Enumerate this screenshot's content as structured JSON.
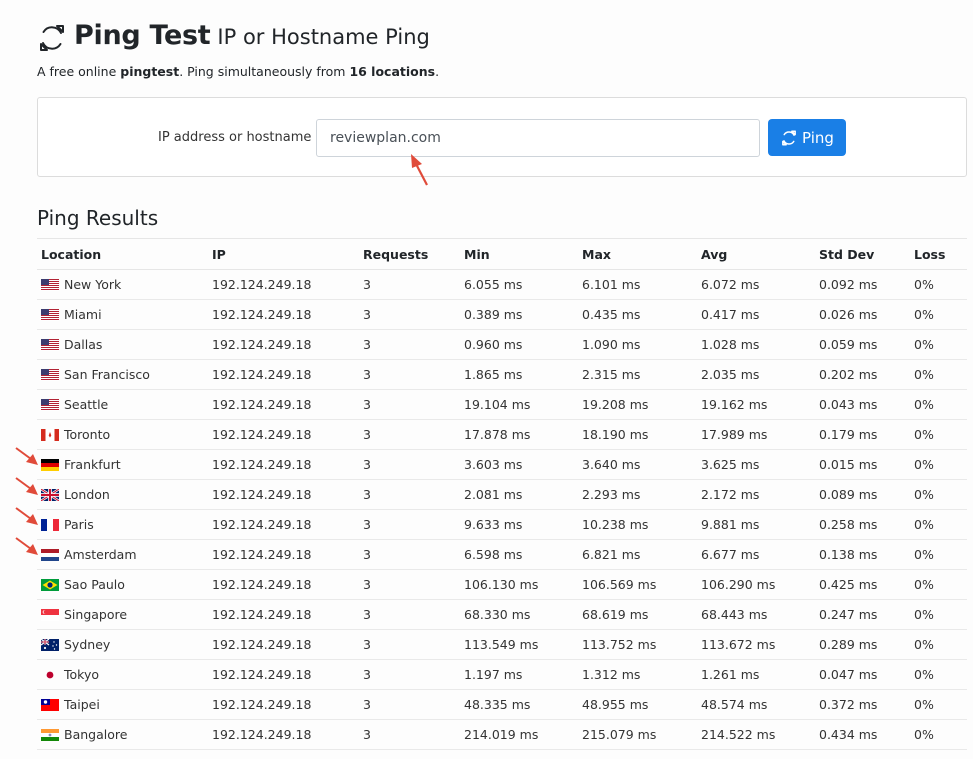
{
  "header": {
    "title": "Ping Test",
    "subtitle": "IP or Hostname Ping",
    "tagline_prefix": "A free online ",
    "tagline_bold1": "pingtest",
    "tagline_middle": ". Ping simultaneously from ",
    "tagline_bold2": "16 locations",
    "tagline_suffix": ".",
    "icon": "refresh-icon"
  },
  "form": {
    "label": "IP address or hostname",
    "input_value": "reviewplan.com",
    "button_label": "Ping",
    "button_icon": "refresh-icon",
    "button_color": "#1a7fe6"
  },
  "results": {
    "title": "Ping Results",
    "columns": [
      "Location",
      "IP",
      "Requests",
      "Min",
      "Max",
      "Avg",
      "Std Dev",
      "Loss"
    ],
    "rows": [
      {
        "flag": "us",
        "location": "New York",
        "ip": "192.124.249.18",
        "requests": "3",
        "min": "6.055 ms",
        "max": "6.101 ms",
        "avg": "6.072 ms",
        "std": "0.092 ms",
        "loss": "0%"
      },
      {
        "flag": "us",
        "location": "Miami",
        "ip": "192.124.249.18",
        "requests": "3",
        "min": "0.389 ms",
        "max": "0.435 ms",
        "avg": "0.417 ms",
        "std": "0.026 ms",
        "loss": "0%"
      },
      {
        "flag": "us",
        "location": "Dallas",
        "ip": "192.124.249.18",
        "requests": "3",
        "min": "0.960 ms",
        "max": "1.090 ms",
        "avg": "1.028 ms",
        "std": "0.059 ms",
        "loss": "0%"
      },
      {
        "flag": "us",
        "location": "San Francisco",
        "ip": "192.124.249.18",
        "requests": "3",
        "min": "1.865 ms",
        "max": "2.315 ms",
        "avg": "2.035 ms",
        "std": "0.202 ms",
        "loss": "0%"
      },
      {
        "flag": "us",
        "location": "Seattle",
        "ip": "192.124.249.18",
        "requests": "3",
        "min": "19.104 ms",
        "max": "19.208 ms",
        "avg": "19.162 ms",
        "std": "0.043 ms",
        "loss": "0%"
      },
      {
        "flag": "ca",
        "location": "Toronto",
        "ip": "192.124.249.18",
        "requests": "3",
        "min": "17.878 ms",
        "max": "18.190 ms",
        "avg": "17.989 ms",
        "std": "0.179 ms",
        "loss": "0%"
      },
      {
        "flag": "de",
        "location": "Frankfurt",
        "ip": "192.124.249.18",
        "requests": "3",
        "min": "3.603 ms",
        "max": "3.640 ms",
        "avg": "3.625 ms",
        "std": "0.015 ms",
        "loss": "0%",
        "marked": true
      },
      {
        "flag": "gb",
        "location": "London",
        "ip": "192.124.249.18",
        "requests": "3",
        "min": "2.081 ms",
        "max": "2.293 ms",
        "avg": "2.172 ms",
        "std": "0.089 ms",
        "loss": "0%",
        "marked": true
      },
      {
        "flag": "fr",
        "location": "Paris",
        "ip": "192.124.249.18",
        "requests": "3",
        "min": "9.633 ms",
        "max": "10.238 ms",
        "avg": "9.881 ms",
        "std": "0.258 ms",
        "loss": "0%",
        "marked": true
      },
      {
        "flag": "nl",
        "location": "Amsterdam",
        "ip": "192.124.249.18",
        "requests": "3",
        "min": "6.598 ms",
        "max": "6.821 ms",
        "avg": "6.677 ms",
        "std": "0.138 ms",
        "loss": "0%",
        "marked": true
      },
      {
        "flag": "br",
        "location": "Sao Paulo",
        "ip": "192.124.249.18",
        "requests": "3",
        "min": "106.130 ms",
        "max": "106.569 ms",
        "avg": "106.290 ms",
        "std": "0.425 ms",
        "loss": "0%"
      },
      {
        "flag": "sg",
        "location": "Singapore",
        "ip": "192.124.249.18",
        "requests": "3",
        "min": "68.330 ms",
        "max": "68.619 ms",
        "avg": "68.443 ms",
        "std": "0.247 ms",
        "loss": "0%"
      },
      {
        "flag": "au",
        "location": "Sydney",
        "ip": "192.124.249.18",
        "requests": "3",
        "min": "113.549 ms",
        "max": "113.752 ms",
        "avg": "113.672 ms",
        "std": "0.289 ms",
        "loss": "0%"
      },
      {
        "flag": "jp",
        "location": "Tokyo",
        "ip": "192.124.249.18",
        "requests": "3",
        "min": "1.197 ms",
        "max": "1.312 ms",
        "avg": "1.261 ms",
        "std": "0.047 ms",
        "loss": "0%"
      },
      {
        "flag": "tw",
        "location": "Taipei",
        "ip": "192.124.249.18",
        "requests": "3",
        "min": "48.335 ms",
        "max": "48.955 ms",
        "avg": "48.574 ms",
        "std": "0.372 ms",
        "loss": "0%"
      },
      {
        "flag": "in",
        "location": "Bangalore",
        "ip": "192.124.249.18",
        "requests": "3",
        "min": "214.019 ms",
        "max": "215.079 ms",
        "avg": "214.522 ms",
        "std": "0.434 ms",
        "loss": "0%"
      }
    ]
  },
  "annotations": {
    "arrow_color": "#e04b3a"
  }
}
